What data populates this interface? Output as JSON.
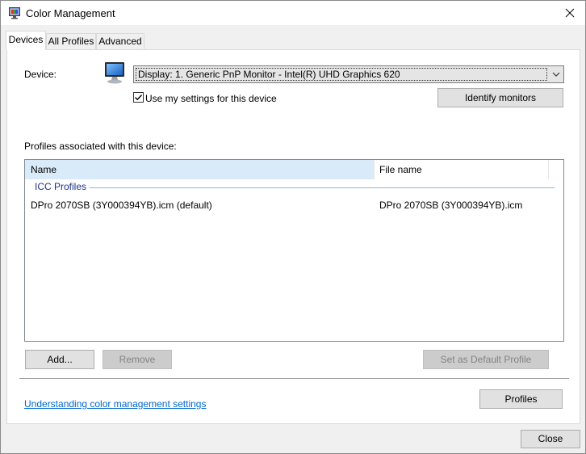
{
  "window": {
    "title": "Color Management",
    "close_label": "Close"
  },
  "tabs": [
    {
      "label": "Devices",
      "active": true
    },
    {
      "label": "All Profiles",
      "active": false
    },
    {
      "label": "Advanced",
      "active": false
    }
  ],
  "device": {
    "label": "Device:",
    "selected": "Display: 1. Generic PnP Monitor - Intel(R) UHD Graphics 620",
    "use_my_settings_label": "Use my settings for this device",
    "use_my_settings_checked": true,
    "identify_button": "Identify monitors"
  },
  "profiles": {
    "section_label": "Profiles associated with this device:",
    "columns": [
      "Name",
      "File name"
    ],
    "group": "ICC Profiles",
    "rows": [
      {
        "name": "DPro 2070SB (3Y000394YB).icm (default)",
        "file": "DPro 2070SB (3Y000394YB).icm"
      }
    ],
    "add_button": "Add...",
    "remove_button": "Remove",
    "set_default_button": "Set as Default Profile"
  },
  "footer": {
    "link_text": "Understanding color management settings",
    "profiles_button": "Profiles"
  },
  "colors": {
    "accent": "#0066cc",
    "selected_header": "#d9ebf9",
    "group_text": "#1e3287"
  }
}
